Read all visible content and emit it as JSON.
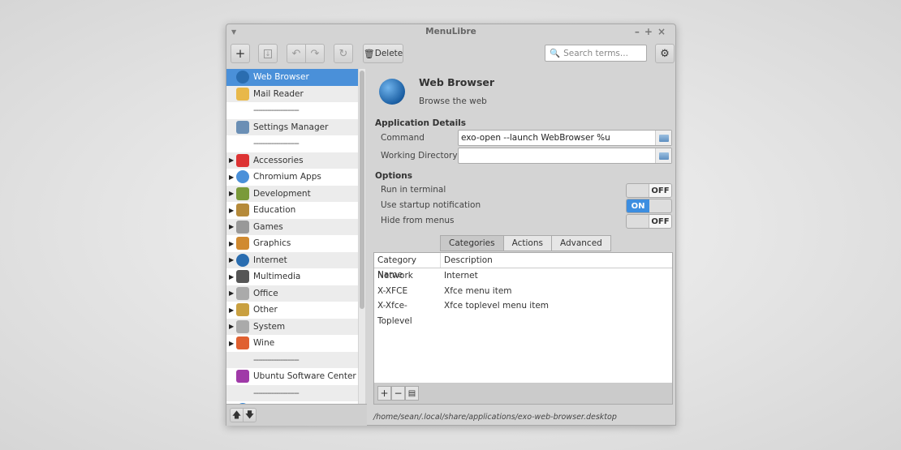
{
  "window": {
    "title": "MenuLibre",
    "controls": [
      "–",
      "+",
      "×"
    ]
  },
  "toolbar": {
    "add": "+",
    "delete_label": "Delete",
    "search_placeholder": "Search terms..."
  },
  "sidebar": {
    "items": [
      {
        "label": "Web Browser",
        "icon": "globe-icon",
        "selected": true,
        "expander": false,
        "color": "#2a6db0"
      },
      {
        "label": "Mail Reader",
        "icon": "mail-icon",
        "expander": false,
        "color": "#e8b84a"
      },
      {
        "label": "--------------------",
        "separator": true
      },
      {
        "label": "Settings Manager",
        "icon": "settings-icon",
        "expander": false,
        "color": "#6b8fb5"
      },
      {
        "label": "--------------------",
        "separator": true
      },
      {
        "label": "Accessories",
        "icon": "accessories-icon",
        "expander": true,
        "color": "#d33"
      },
      {
        "label": "Chromium Apps",
        "icon": "chromium-icon",
        "expander": true,
        "color": "#4a90d9"
      },
      {
        "label": "Development",
        "icon": "development-icon",
        "expander": true,
        "color": "#7a9a3a"
      },
      {
        "label": "Education",
        "icon": "education-icon",
        "expander": true,
        "color": "#b58a3a"
      },
      {
        "label": "Games",
        "icon": "games-icon",
        "expander": true,
        "color": "#999"
      },
      {
        "label": "Graphics",
        "icon": "graphics-icon",
        "expander": true,
        "color": "#d08a30"
      },
      {
        "label": "Internet",
        "icon": "internet-icon",
        "expander": true,
        "color": "#2a6db0"
      },
      {
        "label": "Multimedia",
        "icon": "multimedia-icon",
        "expander": true,
        "color": "#555"
      },
      {
        "label": "Office",
        "icon": "office-icon",
        "expander": true,
        "color": "#aaa"
      },
      {
        "label": "Other",
        "icon": "other-icon",
        "expander": true,
        "color": "#c9a040"
      },
      {
        "label": "System",
        "icon": "system-icon",
        "expander": true,
        "color": "#aaa"
      },
      {
        "label": "Wine",
        "icon": "wine-icon",
        "expander": true,
        "color": "#e06030"
      },
      {
        "label": "--------------------",
        "separator": true
      },
      {
        "label": "Ubuntu Software Center",
        "icon": "software-center-icon",
        "expander": false,
        "color": "#a03aa8"
      },
      {
        "label": "--------------------",
        "separator": true
      },
      {
        "label": "Help",
        "icon": "help-icon",
        "expander": false,
        "color": "#3a8ad9"
      }
    ]
  },
  "app": {
    "name": "Web Browser",
    "comment": "Browse the web"
  },
  "details": {
    "heading": "Application Details",
    "command_label": "Command",
    "command_value": "exo-open --launch WebBrowser %u",
    "workdir_label": "Working Directory",
    "workdir_value": ""
  },
  "options": {
    "heading": "Options",
    "items": [
      {
        "label": "Run in terminal",
        "on": false,
        "text": "OFF"
      },
      {
        "label": "Use startup notification",
        "on": true,
        "text": "ON"
      },
      {
        "label": "Hide from menus",
        "on": false,
        "text": "OFF"
      }
    ]
  },
  "tabs": [
    {
      "label": "Categories",
      "active": true
    },
    {
      "label": "Actions"
    },
    {
      "label": "Advanced"
    }
  ],
  "categories": {
    "headers": [
      "Category Name",
      "Description"
    ],
    "rows": [
      [
        "Network",
        "Internet"
      ],
      [
        "X-XFCE",
        "Xfce menu item"
      ],
      [
        "X-Xfce-Toplevel",
        "Xfce toplevel menu item"
      ]
    ]
  },
  "status_path": "/home/sean/.local/share/applications/exo-web-browser.desktop",
  "accent": "#4a90d9"
}
